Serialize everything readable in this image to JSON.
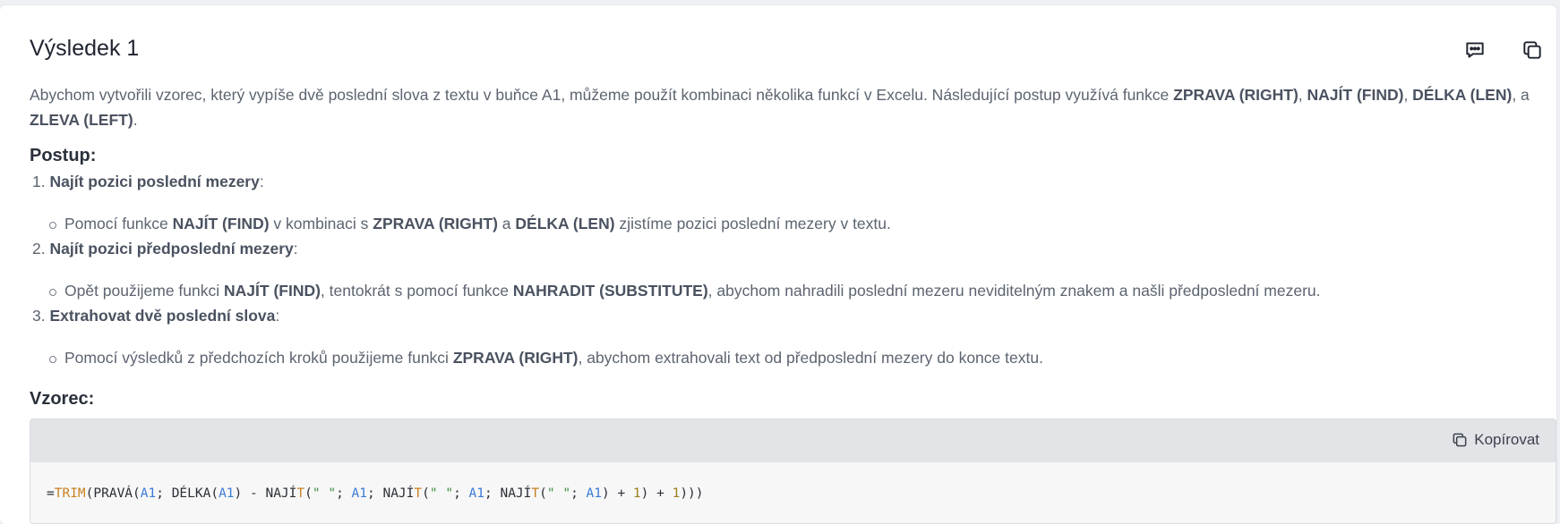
{
  "result": {
    "title": "Výsledek 1",
    "icons": {
      "feedback": "comment-icon",
      "copy": "copy-icon"
    }
  },
  "intro": {
    "t1": "Abychom vytvořili vzorec, který vypíše dvě poslední slova z textu v buňce A1, můžeme použít kombinaci několika funkcí v Excelu. Následující postup využívá funkce ",
    "b1": "ZPRAVA (RIGHT)",
    "t2": ", ",
    "b2": "NAJÍT (FIND)",
    "t3": ", ",
    "b3": "DÉLKA (LEN)",
    "t4": ", a ",
    "b4": "ZLEVA (LEFT)",
    "t5": "."
  },
  "postup": {
    "heading": "Postup:",
    "steps": [
      {
        "num": "1.",
        "title": "Najít pozici poslední mezery",
        "colon": ":",
        "sub": {
          "t1": "Pomocí funkce ",
          "b1": "NAJÍT (FIND)",
          "t2": " v kombinaci s ",
          "b2": "ZPRAVA (RIGHT)",
          "t3": " a ",
          "b3": "DÉLKA (LEN)",
          "t4": " zjistíme pozici poslední mezery v textu."
        }
      },
      {
        "num": "2.",
        "title": "Najít pozici předposlední mezery",
        "colon": ":",
        "sub": {
          "t1": "Opět použijeme funkci ",
          "b1": "NAJÍT (FIND)",
          "t2": ", tentokrát s pomocí funkce ",
          "b2": "NAHRADIT (SUBSTITUTE)",
          "t3": ", abychom nahradili poslední mezeru neviditelným znakem a našli předposlední mezeru."
        }
      },
      {
        "num": "3.",
        "title": "Extrahovat dvě poslední slova",
        "colon": ":",
        "sub": {
          "t1": "Pomocí výsledků z předchozích kroků použijeme funkci ",
          "b1": "ZPRAVA (RIGHT)",
          "t2": ", abychom extrahovali text od předposlední mezery do konce textu."
        }
      }
    ]
  },
  "vzorec": {
    "heading": "Vzorec:",
    "copy_label": "Kopírovat",
    "code": {
      "p1": "=",
      "f1": "TRIM",
      "p2": "(PRAVÁ(",
      "r1": "A1",
      "p3": "; DÉLKA(",
      "r2": "A1",
      "p4": ") - NAJÍ",
      "f2": "T",
      "p5": "(",
      "s1": "\" \"",
      "p6": "; ",
      "r3": "A1",
      "p7": "; NAJÍ",
      "f3": "T",
      "p8": "(",
      "s2": "\" \"",
      "p9": "; ",
      "r4": "A1",
      "p10": "; NAJÍ",
      "f4": "T",
      "p11": "(",
      "s3": "\" \"",
      "p12": "; ",
      "r5": "A1",
      "p13": ") + ",
      "n1": "1",
      "p14": ") + ",
      "n2": "1",
      "p15": ")))"
    }
  }
}
